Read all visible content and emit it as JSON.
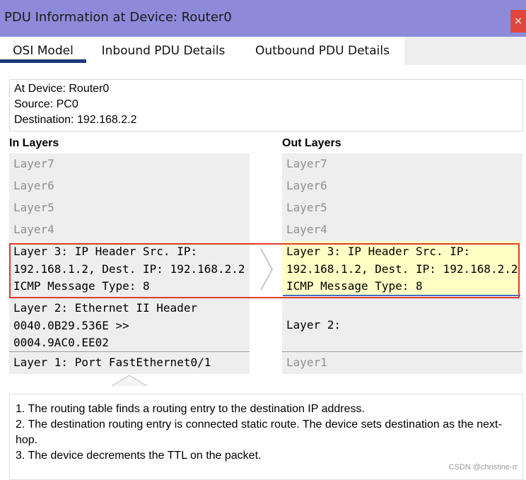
{
  "window": {
    "title": "PDU Information at Device: Router0",
    "close_label": "×"
  },
  "tabs": [
    {
      "label": "OSI Model",
      "active": true
    },
    {
      "label": "Inbound PDU Details",
      "active": false
    },
    {
      "label": "Outbound PDU Details",
      "active": false
    }
  ],
  "device_info": {
    "at_device": "At Device: Router0",
    "source": "Source: PC0",
    "destination": "Destination: 192.168.2.2"
  },
  "in_layers": {
    "heading": "In Layers",
    "layer7": "Layer7",
    "layer6": "Layer6",
    "layer5": "Layer5",
    "layer4": "Layer4",
    "layer3_line1": "Layer 3: IP Header Src. IP:",
    "layer3_line2": "192.168.1.2, Dest. IP: 192.168.2.2",
    "layer3_line3": "ICMP Message Type: 8",
    "layer2_line1": "Layer 2: Ethernet II Header",
    "layer2_line2": "0040.0B29.536E >>",
    "layer2_line3": "0004.9AC0.EE02",
    "layer1": "Layer 1: Port FastEthernet0/1"
  },
  "out_layers": {
    "heading": "Out Layers",
    "layer7": "Layer7",
    "layer6": "Layer6",
    "layer5": "Layer5",
    "layer4": "Layer4",
    "layer3_line1": "Layer 3: IP Header Src. IP:",
    "layer3_line2": "192.168.1.2, Dest. IP: 192.168.2.2",
    "layer3_line3": "ICMP Message Type: 8",
    "layer2": "Layer 2:",
    "layer1": "Layer1"
  },
  "description": {
    "line1": "1. The routing table finds a routing entry to the destination IP address.",
    "line2": "2. The destination routing entry is connected static route. The device sets destination as the next-hop.",
    "line3": "3. The device decrements the TTL on the packet."
  },
  "watermark": "CSDN @christine-rr",
  "colors": {
    "titlebar": "#8d8bd9",
    "highlight_yellow": "#ffffc6",
    "annotation_red": "#e23a2a",
    "tab_underline": "#1a3a74"
  }
}
